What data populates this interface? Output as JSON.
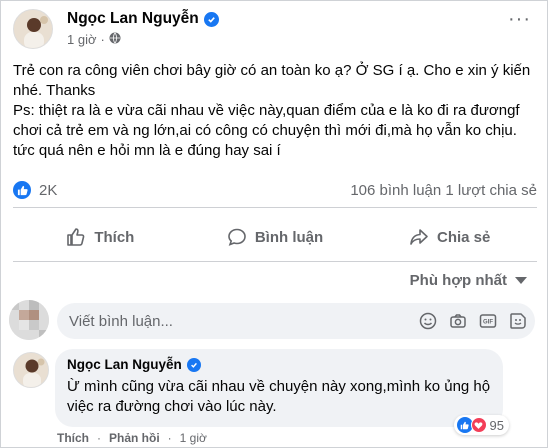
{
  "post": {
    "author": "Ngọc Lan Nguyễn",
    "time": "1 giờ",
    "paragraphs": [
      "Trẻ con ra công viên chơi bây giờ có an toàn ko ạ? Ở SG í ạ. Cho e xin ý kiến nhé. Thanks",
      "Ps: thiệt ra là e vừa cãi nhau về việc này,quan điểm của e là ko đi ra đươngf chơi cả trẻ em và ng lớn,ai có công có chuyện thì mới đi,mà họ vẫn ko chịu. tức quá nên e hỏi mn là e đúng hay sai í"
    ],
    "likes": "2K",
    "comments_shares": "106 bình luận  1 lượt chia sẻ"
  },
  "actions": {
    "like": "Thích",
    "comment": "Bình luận",
    "share": "Chia sẻ"
  },
  "sort_label": "Phù hợp nhất",
  "composer": {
    "placeholder": "Viết bình luận..."
  },
  "comment": {
    "author": "Ngọc Lan Nguyễn",
    "text": "Ừ mình cũng vừa cãi nhau về chuyện này xong,mình ko ủng hộ việc ra đường chơi vào lúc này.",
    "reaction_count": "95",
    "like_label": "Thích",
    "reply_label": "Phản hồi",
    "time": "1 giờ"
  },
  "colors": {
    "accent": "#1877f2",
    "muted": "#65676b",
    "bubble": "#f0f2f5",
    "heart": "#f33e58"
  },
  "icons": [
    "verified-icon",
    "globe-icon",
    "more-icon",
    "like-icon",
    "comment-icon",
    "share-icon",
    "emoji-icon",
    "camera-icon",
    "gif-icon",
    "sticker-icon",
    "heart-icon"
  ]
}
